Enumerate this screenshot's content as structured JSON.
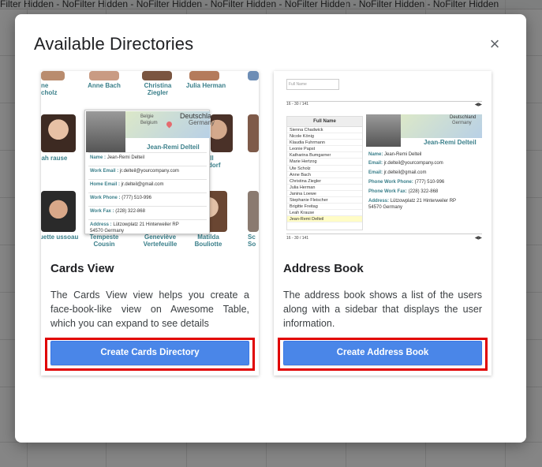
{
  "background": {
    "toolbar_text": "Filter   Hidden - NoFilter Hidden - NoFilter Hidden - NoFilter Hidden - NoFilter Hidden - NoFilter Hidden - NoFilter Hidden"
  },
  "dialog": {
    "title": "Available Directories",
    "close_icon": "close-icon"
  },
  "cards": [
    {
      "title": "Cards View",
      "description": "The Cards View view helps you create a face-book-like view on Awesome Table, which you can expand to see details",
      "button_label": "Create Cards Directory",
      "preview": {
        "tiles": [
          {
            "name": "",
            "row": 0
          },
          {
            "name": "Anne Bach"
          },
          {
            "name": "Christina Ziegler"
          },
          {
            "name": "Julia Herman"
          },
          {
            "name": "eah rause"
          },
          {
            "name": "uette ussoau"
          },
          {
            "name": "Tempeste Cousin"
          },
          {
            "name": "Geneviève Vertefeuille"
          },
          {
            "name": "Matilda Bouliotte"
          }
        ],
        "popup": {
          "name": "Jean-Remi Delteil",
          "map_line1": "Deutschla",
          "map_line2": "Germany",
          "map_line3": "Belgie",
          "map_line4": "Belgium",
          "name_label": "Name :",
          "name_value": "Jean-Remi Delteil",
          "work_email_label": "Work Email :",
          "work_email_value": "jr.delteil@yourcompany.com",
          "home_email_label": "Home Email :",
          "home_email_value": "jr.delteil@gmail.com",
          "work_phone_label": "Work Phone :",
          "work_phone_value": "(777) 510-996",
          "work_fax_label": "Work Fax :",
          "work_fax_value": "(228) 322-868",
          "address_label": "Address :",
          "address_value": "Lützowplatz 21 Hinterweiler RP",
          "address_value2": "54570 Germany"
        }
      }
    },
    {
      "title": "Address Book",
      "description": "The address book shows a list of the users along with a sidebar that displays the user information.",
      "button_label": "Create Address Book",
      "preview": {
        "search_placeholder": "Full Name",
        "pager": "16 - 30 / 141",
        "list_header": "Full Name",
        "list": [
          "Sienna Chadwick",
          "Nicole König",
          "Klaudia Fuhrmann",
          "Leonie Papst",
          "Katharina Bumgarner",
          "Marie Hertzog",
          "Ute Scholz",
          "Anne Bach",
          "Christina Ziegler",
          "Julia Herman",
          "Janina Loewe",
          "Stephanie Fleischer",
          "Brigitte Freitag",
          "Leah Krause",
          "Jean-Remi Delteil"
        ],
        "selected": "Jean-Remi Delteil",
        "detail": {
          "name": "Jean-Remi Delteil",
          "map_line1": "Deutschland",
          "map_line2": "Germany",
          "name_label": "Name:",
          "name_value": "Jean-Remi Delteil",
          "email_label": "Email:",
          "email_value": "jr.delteil@yourcompany.com",
          "email2_label": "Email:",
          "email2_value": "jr.delteil@gmail.com",
          "phone_label": "Phone Work Phone:",
          "phone_value": "(777) 510-996",
          "fax_label": "Phone Work Fax:",
          "fax_value": "(228) 322-868",
          "address_label": "Address:",
          "address_value": "Lützowplatz 21 Hinterweiler RP",
          "address_value2": "54570 Germany"
        }
      }
    }
  ]
}
